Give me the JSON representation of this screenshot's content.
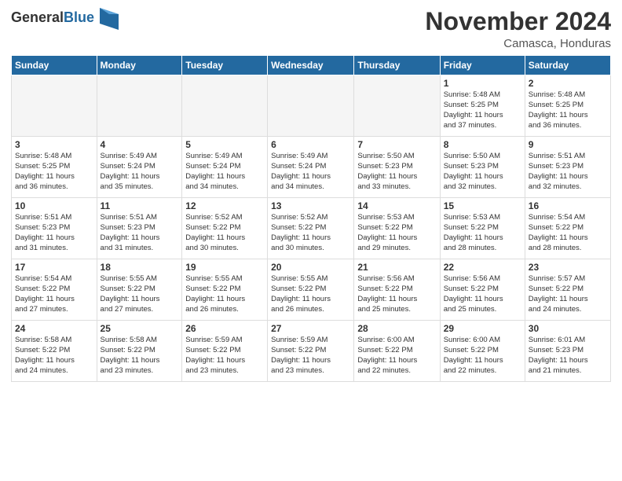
{
  "header": {
    "logo_general": "General",
    "logo_blue": "Blue",
    "month": "November 2024",
    "location": "Camasca, Honduras"
  },
  "weekdays": [
    "Sunday",
    "Monday",
    "Tuesday",
    "Wednesday",
    "Thursday",
    "Friday",
    "Saturday"
  ],
  "weeks": [
    [
      {
        "day": "",
        "info": ""
      },
      {
        "day": "",
        "info": ""
      },
      {
        "day": "",
        "info": ""
      },
      {
        "day": "",
        "info": ""
      },
      {
        "day": "",
        "info": ""
      },
      {
        "day": "1",
        "info": "Sunrise: 5:48 AM\nSunset: 5:25 PM\nDaylight: 11 hours\nand 37 minutes."
      },
      {
        "day": "2",
        "info": "Sunrise: 5:48 AM\nSunset: 5:25 PM\nDaylight: 11 hours\nand 36 minutes."
      }
    ],
    [
      {
        "day": "3",
        "info": "Sunrise: 5:48 AM\nSunset: 5:25 PM\nDaylight: 11 hours\nand 36 minutes."
      },
      {
        "day": "4",
        "info": "Sunrise: 5:49 AM\nSunset: 5:24 PM\nDaylight: 11 hours\nand 35 minutes."
      },
      {
        "day": "5",
        "info": "Sunrise: 5:49 AM\nSunset: 5:24 PM\nDaylight: 11 hours\nand 34 minutes."
      },
      {
        "day": "6",
        "info": "Sunrise: 5:49 AM\nSunset: 5:24 PM\nDaylight: 11 hours\nand 34 minutes."
      },
      {
        "day": "7",
        "info": "Sunrise: 5:50 AM\nSunset: 5:23 PM\nDaylight: 11 hours\nand 33 minutes."
      },
      {
        "day": "8",
        "info": "Sunrise: 5:50 AM\nSunset: 5:23 PM\nDaylight: 11 hours\nand 32 minutes."
      },
      {
        "day": "9",
        "info": "Sunrise: 5:51 AM\nSunset: 5:23 PM\nDaylight: 11 hours\nand 32 minutes."
      }
    ],
    [
      {
        "day": "10",
        "info": "Sunrise: 5:51 AM\nSunset: 5:23 PM\nDaylight: 11 hours\nand 31 minutes."
      },
      {
        "day": "11",
        "info": "Sunrise: 5:51 AM\nSunset: 5:23 PM\nDaylight: 11 hours\nand 31 minutes."
      },
      {
        "day": "12",
        "info": "Sunrise: 5:52 AM\nSunset: 5:22 PM\nDaylight: 11 hours\nand 30 minutes."
      },
      {
        "day": "13",
        "info": "Sunrise: 5:52 AM\nSunset: 5:22 PM\nDaylight: 11 hours\nand 30 minutes."
      },
      {
        "day": "14",
        "info": "Sunrise: 5:53 AM\nSunset: 5:22 PM\nDaylight: 11 hours\nand 29 minutes."
      },
      {
        "day": "15",
        "info": "Sunrise: 5:53 AM\nSunset: 5:22 PM\nDaylight: 11 hours\nand 28 minutes."
      },
      {
        "day": "16",
        "info": "Sunrise: 5:54 AM\nSunset: 5:22 PM\nDaylight: 11 hours\nand 28 minutes."
      }
    ],
    [
      {
        "day": "17",
        "info": "Sunrise: 5:54 AM\nSunset: 5:22 PM\nDaylight: 11 hours\nand 27 minutes."
      },
      {
        "day": "18",
        "info": "Sunrise: 5:55 AM\nSunset: 5:22 PM\nDaylight: 11 hours\nand 27 minutes."
      },
      {
        "day": "19",
        "info": "Sunrise: 5:55 AM\nSunset: 5:22 PM\nDaylight: 11 hours\nand 26 minutes."
      },
      {
        "day": "20",
        "info": "Sunrise: 5:55 AM\nSunset: 5:22 PM\nDaylight: 11 hours\nand 26 minutes."
      },
      {
        "day": "21",
        "info": "Sunrise: 5:56 AM\nSunset: 5:22 PM\nDaylight: 11 hours\nand 25 minutes."
      },
      {
        "day": "22",
        "info": "Sunrise: 5:56 AM\nSunset: 5:22 PM\nDaylight: 11 hours\nand 25 minutes."
      },
      {
        "day": "23",
        "info": "Sunrise: 5:57 AM\nSunset: 5:22 PM\nDaylight: 11 hours\nand 24 minutes."
      }
    ],
    [
      {
        "day": "24",
        "info": "Sunrise: 5:58 AM\nSunset: 5:22 PM\nDaylight: 11 hours\nand 24 minutes."
      },
      {
        "day": "25",
        "info": "Sunrise: 5:58 AM\nSunset: 5:22 PM\nDaylight: 11 hours\nand 23 minutes."
      },
      {
        "day": "26",
        "info": "Sunrise: 5:59 AM\nSunset: 5:22 PM\nDaylight: 11 hours\nand 23 minutes."
      },
      {
        "day": "27",
        "info": "Sunrise: 5:59 AM\nSunset: 5:22 PM\nDaylight: 11 hours\nand 23 minutes."
      },
      {
        "day": "28",
        "info": "Sunrise: 6:00 AM\nSunset: 5:22 PM\nDaylight: 11 hours\nand 22 minutes."
      },
      {
        "day": "29",
        "info": "Sunrise: 6:00 AM\nSunset: 5:22 PM\nDaylight: 11 hours\nand 22 minutes."
      },
      {
        "day": "30",
        "info": "Sunrise: 6:01 AM\nSunset: 5:23 PM\nDaylight: 11 hours\nand 21 minutes."
      }
    ]
  ]
}
